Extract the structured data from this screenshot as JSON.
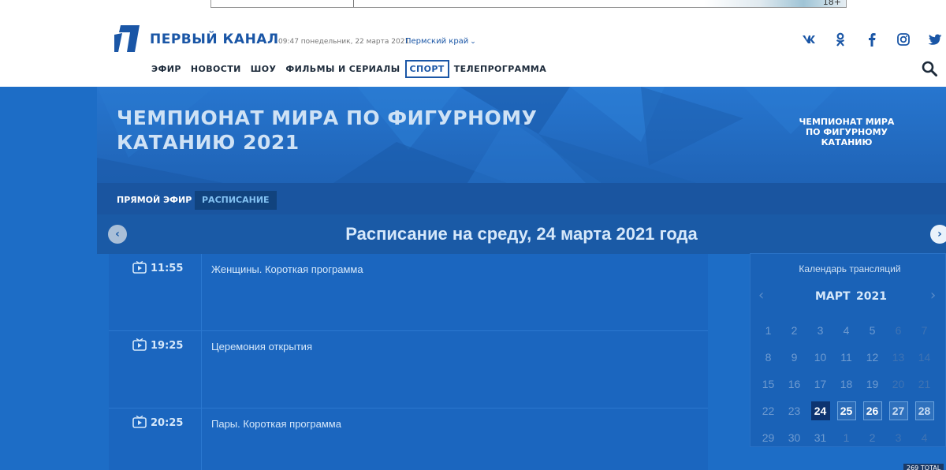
{
  "ad": {
    "age_rating": "18+"
  },
  "header": {
    "brand": "ПЕРВЫЙ КАНАЛ",
    "datetime": "09:47 понедельник, 22 марта 2021",
    "region": "Пермский край",
    "nav": [
      "ЭФИР",
      "НОВОСТИ",
      "ШОУ",
      "ФИЛЬМЫ И СЕРИАЛЫ",
      "СПОРТ",
      "ТЕЛЕПРОГРАММА"
    ],
    "nav_active": "СПОРТ",
    "socials": {
      "vk": "vk",
      "ok": "ok",
      "fb": "f",
      "ig": "instagram",
      "tw": "twitter"
    },
    "brand_color": "#1a56a6"
  },
  "hero": {
    "title_line1": "ЧЕМПИОНАТ МИРА ПО ФИГУРНОМУ",
    "title_line2": "КАТАНИЮ 2021",
    "badge_line1": "ЧЕМПИОНАТ МИРА",
    "badge_line2": "ПО ФИГУРНОМУ",
    "badge_line3": "КАТАНИЮ"
  },
  "subnav": {
    "live": "ПРЯМОЙ ЭФИР",
    "schedule": "РАСПИСАНИЕ"
  },
  "schedule": {
    "title": "Расписание на среду, 24 марта 2021 года",
    "rows": [
      {
        "time": "11:55",
        "title": "Женщины. Короткая программа"
      },
      {
        "time": "19:25",
        "title": "Церемония открытия"
      },
      {
        "time": "20:25",
        "title": "Пары. Короткая программа"
      }
    ]
  },
  "calendar": {
    "caption": "Календарь трансляций",
    "month": "МАРТ",
    "year": "2021",
    "weeks": [
      [
        "1",
        "2",
        "3",
        "4",
        "5",
        "6",
        "7"
      ],
      [
        "8",
        "9",
        "10",
        "11",
        "12",
        "13",
        "14"
      ],
      [
        "15",
        "16",
        "17",
        "18",
        "19",
        "20",
        "21"
      ],
      [
        "22",
        "23",
        "24",
        "25",
        "26",
        "27",
        "28"
      ],
      [
        "29",
        "30",
        "31",
        "1",
        "2",
        "3",
        "4"
      ]
    ]
  },
  "corner_tag": "269 TOTAL"
}
